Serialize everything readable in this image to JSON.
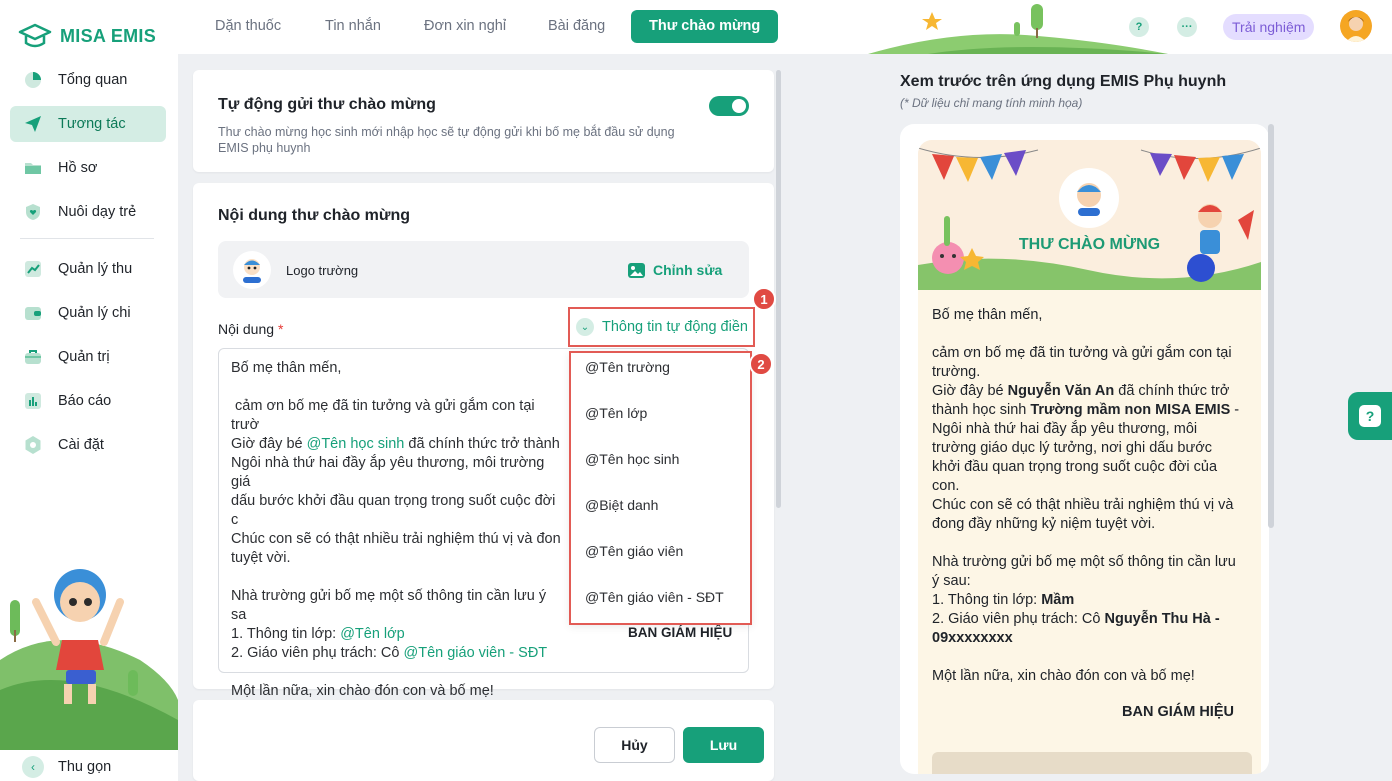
{
  "app": {
    "logo_text": "MISA EMIS"
  },
  "sidebar": {
    "items": [
      {
        "label": "Tổng quan"
      },
      {
        "label": "Tương tác"
      },
      {
        "label": "Hồ sơ"
      },
      {
        "label": "Nuôi dạy trẻ"
      },
      {
        "label": "Quản lý thu"
      },
      {
        "label": "Quản lý chi"
      },
      {
        "label": "Quản trị"
      },
      {
        "label": "Báo cáo"
      },
      {
        "label": "Cài đặt"
      }
    ],
    "collapse_label": "Thu gọn"
  },
  "topbar": {
    "tabs": [
      {
        "label": "Dặn thuốc"
      },
      {
        "label": "Tin nhắn"
      },
      {
        "label": "Đơn xin nghỉ"
      },
      {
        "label": "Bài đăng"
      },
      {
        "label": "Thư chào mừng"
      }
    ],
    "help_glyph": "?",
    "more_glyph": "···",
    "trial_label": "Trải nghiệm"
  },
  "auto_send": {
    "title": "Tự động gửi thư chào mừng",
    "description": "Thư chào mừng học sinh mới nhập học sẽ tự động gửi khi bố mẹ bắt đầu sử dụng EMIS phụ huynh",
    "enabled": true
  },
  "content": {
    "title": "Nội dung thư chào mừng",
    "logo_label": "Logo trường",
    "edit_label": "Chỉnh sửa",
    "field_label": "Nội dung",
    "required_mark": "*",
    "auto_fill_label": "Thông tin tự động điền",
    "editor": {
      "greeting": "Bố mẹ thân mến,",
      "line1": "cảm ơn bố mẹ đã tin tưởng và gửi gắm con tại trườ",
      "line2a": "Giờ đây bé ",
      "line2_tag": "@Tên học sinh",
      "line2b": " đã chính thức trở thành",
      "line3": "Ngôi nhà thứ hai đầy ắp yêu thương, môi trường giá",
      "line4": "dấu bước khởi đầu quan trọng trong suốt cuộc đời c",
      "line5": "Chúc con sẽ có thật nhiều trải nghiệm thú vị và đon",
      "line6": "tuyệt vời.",
      "line7": "Nhà trường gửi bố mẹ một số thông tin cần lưu ý sa",
      "info1": " 1. Thông tin lớp: ",
      "info1_tag": "@Tên lớp",
      "info2": " 2. Giáo viên phụ trách: Cô ",
      "info2_tag": "@Tên giáo viên - SĐT",
      "closing": "Một lần nữa, xin chào đón con và bố mẹ!",
      "signature": "BAN GIÁM HIỆU"
    },
    "dropdown_options": [
      "@Tên trường",
      "@Tên lớp",
      "@Tên học sinh",
      "@Biệt danh",
      "@Tên giáo viên",
      "@Tên giáo viên - SĐT"
    ],
    "badge1": "1",
    "badge2": "2"
  },
  "footer": {
    "cancel_label": "Hủy",
    "save_label": "Lưu"
  },
  "preview": {
    "title": "Xem trước trên ứng dụng EMIS Phụ huynh",
    "note": "(* Dữ liệu chỉ mang tính minh họa)",
    "banner_title": "THƯ CHÀO MỪNG",
    "greeting": "Bố mẹ thân mến,",
    "line1": " cảm ơn bố mẹ đã tin tưởng và gửi gắm con tại trường.",
    "line2a": "Giờ đây bé ",
    "student": "Nguyễn Văn An",
    "line2b": " đã chính thức trở thành học sinh ",
    "school": "Trường mầm non MISA EMIS",
    "line3": " - Ngôi nhà thứ hai đầy ắp yêu thương, môi trường giáo dục lý tưởng, nơi ghi dấu bước khởi đầu quan trọng trong suốt cuộc đời của con.",
    "line4": "Chúc con sẽ có thật nhiều trải nghiệm thú vị và đong đầy những kỷ niệm tuyệt vời.",
    "line5": "Nhà trường gửi bố mẹ một số thông tin cần lưu ý sau:",
    "info1": " 1. Thông tin lớp: ",
    "class_name": "Mầm",
    "info2": " 2. Giáo viên phụ trách: Cô ",
    "teacher": "Nguyễn Thu Hà - 09xxxxxxxx",
    "closing": "Một lần nữa, xin chào đón con và bố mẹ!",
    "signature": "BAN GIÁM HIỆU"
  },
  "colors": {
    "accent": "#17a07a",
    "highlight": "#e25b55",
    "trial": "#7c5cd6"
  }
}
